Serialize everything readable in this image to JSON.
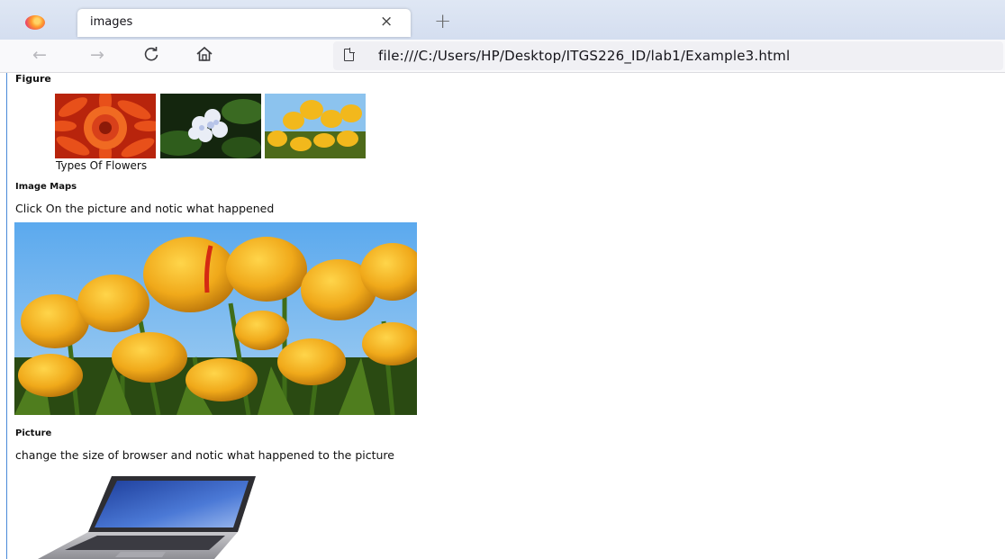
{
  "browser": {
    "tab_title": "images",
    "tab_close": "×",
    "new_tab": "+",
    "nav": {
      "back": "←",
      "forward": "→",
      "reload": "C",
      "home": "⌂"
    },
    "url": "file:///C:/Users/HP/Desktop/ITGS226_ID/lab1/Example3.html"
  },
  "page": {
    "figure_heading": "Figure",
    "figure_caption": "Types Of Flowers",
    "image_maps_heading": "Image Maps",
    "image_maps_text": "Click On the picture and notic what happened",
    "picture_heading": "Picture",
    "picture_text": "change the size of browser and notic what happened to the picture"
  },
  "icons": [
    "firefox-icon",
    "back-icon",
    "forward-icon",
    "reload-icon",
    "home-icon",
    "page-icon"
  ],
  "colors": {
    "tabbar_bg": "#d4def0",
    "navbar_bg": "#f9f9fb",
    "urlbar_bg": "#f0f0f4",
    "page_border": "#4a8ad8"
  }
}
